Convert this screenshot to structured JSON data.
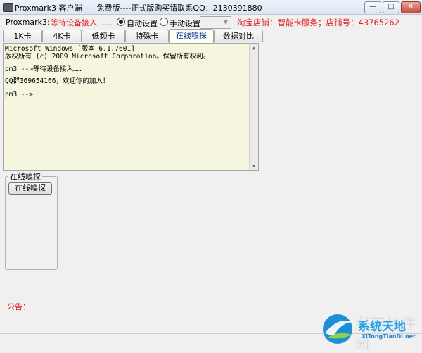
{
  "window": {
    "title": "Proxmark3 客户端      免费版----正式版购买请联系QQ：2130391880",
    "minimize_label": "—",
    "maximize_label": "□",
    "close_label": "✕"
  },
  "topbar": {
    "device_label": "Proxmark3:",
    "device_status": "等待设备接入……",
    "auto_setting_label": "自动设置",
    "manual_setting_label": "手动设置",
    "auto_selected": true,
    "shop_info": "淘宝店铺：智能卡服务；店铺号：43765262",
    "combo_value": ""
  },
  "tabs": [
    {
      "label": "1K卡"
    },
    {
      "label": "4K卡"
    },
    {
      "label": "低频卡"
    },
    {
      "label": "特殊卡"
    },
    {
      "label": "在线嗅探"
    },
    {
      "label": "数据对比"
    }
  ],
  "active_tab": "在线嗅探",
  "console": {
    "lines": [
      "Microsoft Windows [版本 6.1.7601]",
      "版权所有 (c) 2009 Microsoft Corporation。保留所有权利。",
      "",
      "pm3 -->等待设备接入……",
      "",
      "QQ群369654166，欢迎你的加入！",
      "",
      "pm3 -->"
    ]
  },
  "sniff_group": {
    "title": "在线嗅探",
    "button_label": "在线嗅探"
  },
  "notice_label": "公告：",
  "watermark": {
    "faded_text": "兴下软件园",
    "logo_main": "系统天地",
    "logo_sub": "XiTongTianDi.net"
  },
  "colors": {
    "accent_red": "#e41b1b",
    "active_tab_text": "#0e3b9f",
    "console_bg": "#f6f5dd",
    "logo_blue": "#21a2e7"
  }
}
